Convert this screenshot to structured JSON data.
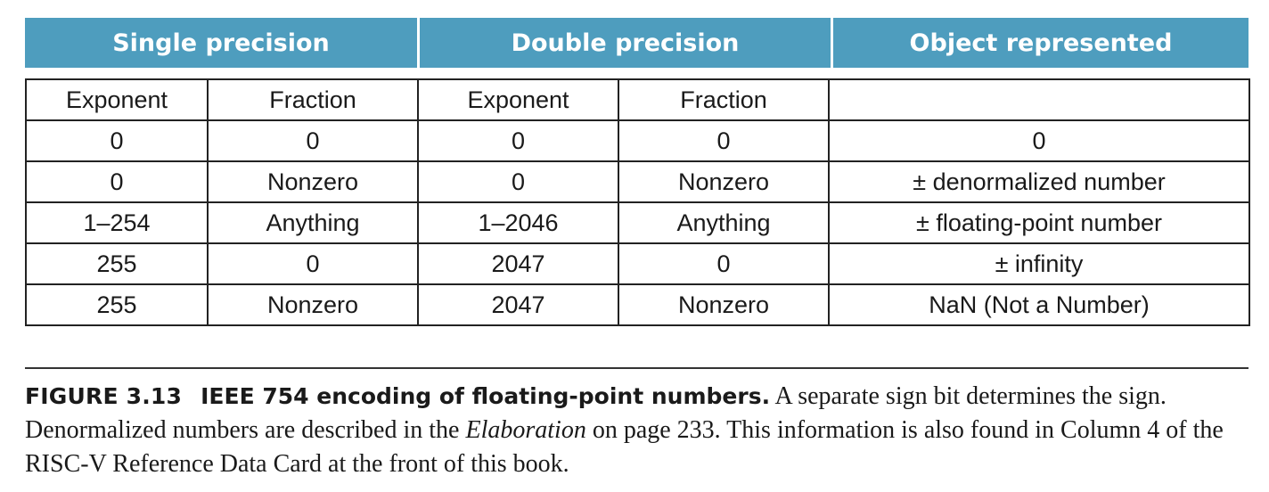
{
  "table": {
    "group_headers": {
      "single": "Single precision",
      "double": "Double precision",
      "object": "Object represented"
    },
    "sub_headers": [
      "Exponent",
      "Fraction",
      "Exponent",
      "Fraction",
      ""
    ],
    "rows": [
      [
        "0",
        "0",
        "0",
        "0",
        "0"
      ],
      [
        "0",
        "Nonzero",
        "0",
        "Nonzero",
        "± denormalized number"
      ],
      [
        "1–254",
        "Anything",
        "1–2046",
        "Anything",
        "± floating-point number"
      ],
      [
        "255",
        "0",
        "2047",
        "0",
        "± infinity"
      ],
      [
        "255",
        "Nonzero",
        "2047",
        "Nonzero",
        "NaN (Not a Number)"
      ]
    ]
  },
  "caption": {
    "label": "FIGURE 3.13",
    "title": "IEEE 754 encoding of floating-point numbers.",
    "text_before_em": "A separate sign bit determines the sign. Denormalized numbers are described in the",
    "em": "Elaboration",
    "text_after_em": "on page 233. This information is also found in Column 4 of the RISC-V Reference Data Card at the front of this book."
  }
}
